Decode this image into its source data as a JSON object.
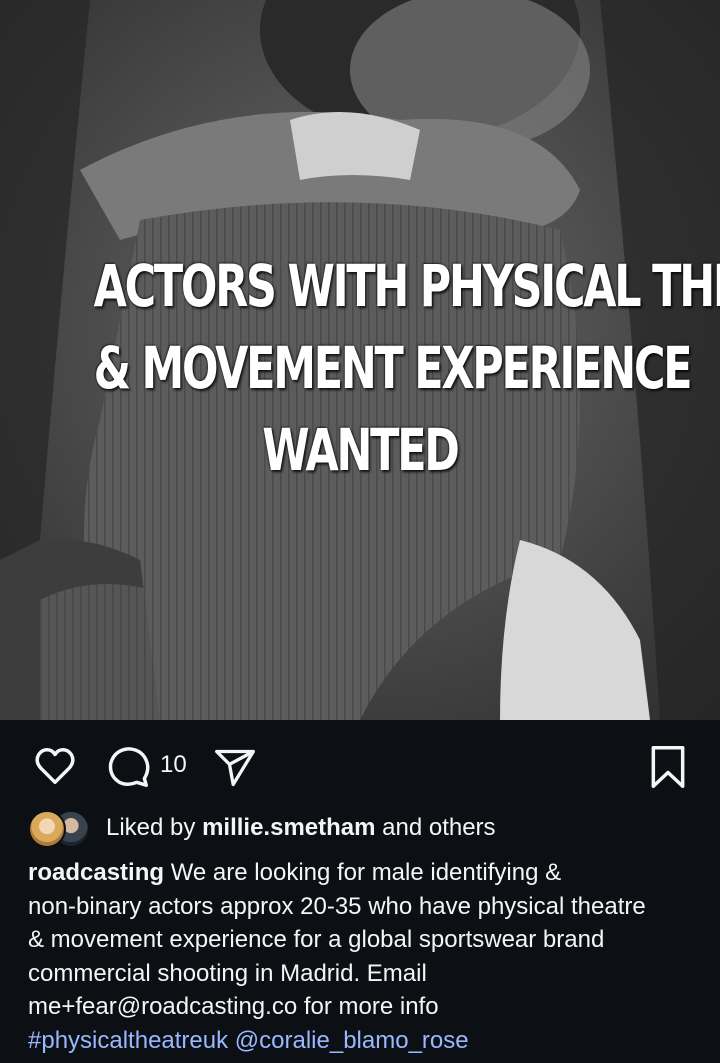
{
  "post": {
    "image_headline": [
      "ACTORS WITH PHYSICAL THEATRE",
      "& MOVEMENT EXPERIENCE",
      "WANTED"
    ]
  },
  "actions": {
    "like_icon": "heart-outline-icon",
    "comment_icon": "comment-bubble-icon",
    "comment_count": "10",
    "share_icon": "paper-plane-icon",
    "save_icon": "bookmark-icon"
  },
  "likes": {
    "prefix": "Liked by ",
    "user": "millie.smetham",
    "suffix": " and others"
  },
  "caption": {
    "username": "roadcasting",
    "lines": [
      " We are looking for male identifying &",
      "non-binary actors approx 20-35 who have physical theatre",
      "& movement experience for a global sportswear brand",
      "commercial shooting in Madrid. Email",
      "me+fear@roadcasting.co for more info"
    ],
    "hashtag": "#physicaltheatreuk",
    "mention": "@coralie_blamo_rose"
  },
  "colors": {
    "background": "#0c1014",
    "text": "#f5f5f5",
    "link": "#9ab7ff"
  }
}
